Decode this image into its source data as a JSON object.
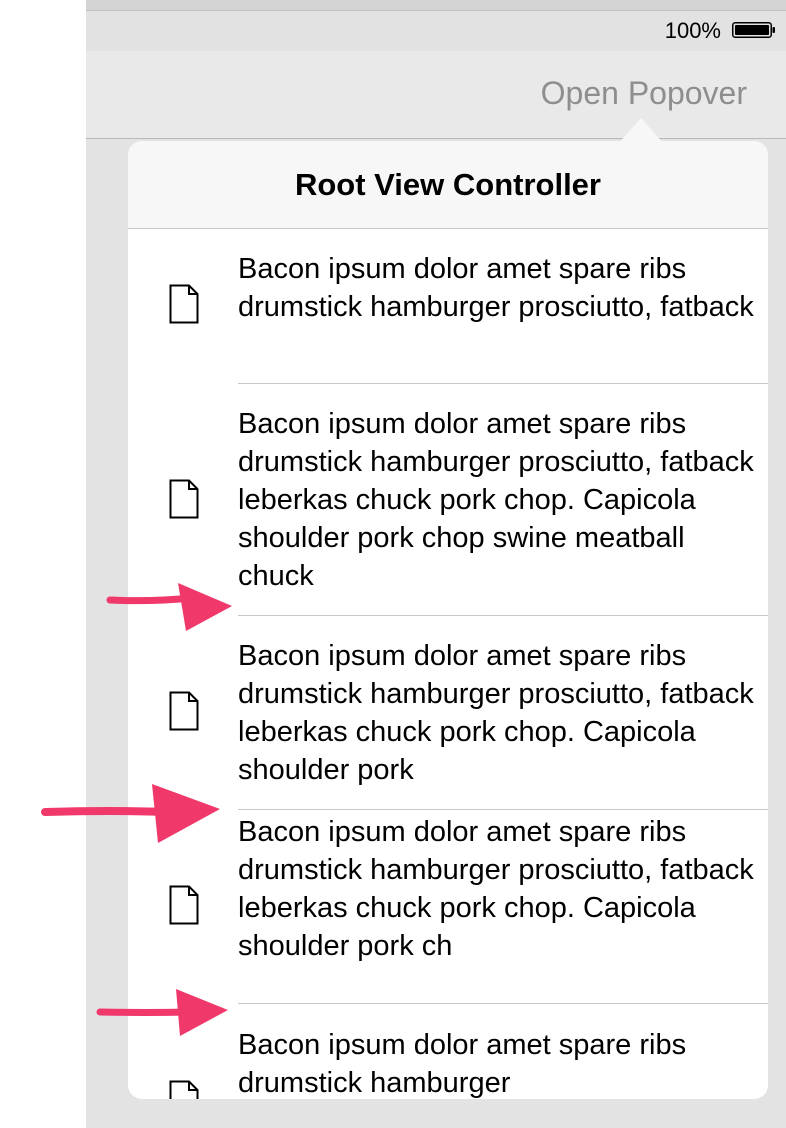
{
  "status_bar": {
    "battery_percent": "100%"
  },
  "navbar": {
    "open_popover_label": "Open Popover"
  },
  "popover": {
    "title": "Root View Controller",
    "rows": [
      {
        "icon": "document-icon",
        "text": "Bacon ipsum dolor amet spare ribs drumstick hamburger prosciutto, fatback"
      },
      {
        "icon": "document-icon",
        "text": "Bacon ipsum dolor amet spare ribs drumstick hamburger prosciutto, fatback leberkas chuck pork chop. Capicola shoulder pork chop swine meatball chuck"
      },
      {
        "icon": "document-icon",
        "text": "Bacon ipsum dolor amet spare ribs drumstick hamburger prosciutto, fatback leberkas chuck pork chop. Capicola shoulder pork"
      },
      {
        "icon": "document-icon",
        "text": "Bacon ipsum dolor amet spare ribs drumstick hamburger prosciutto, fatback leberkas chuck pork chop. Capicola shoulder pork ch"
      },
      {
        "icon": "document-icon",
        "text": "Bacon ipsum dolor amet spare ribs drumstick hamburger"
      }
    ]
  },
  "annotation_color": "#f0386b"
}
